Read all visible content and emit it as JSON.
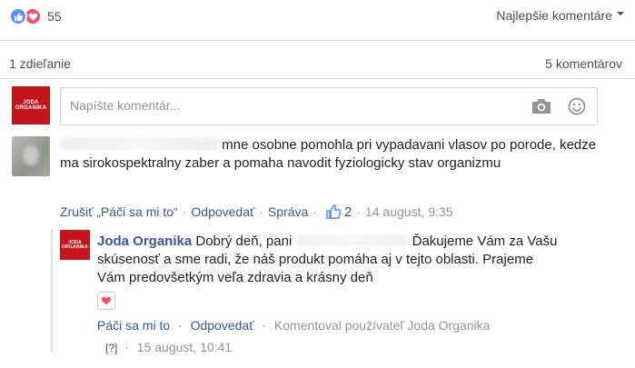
{
  "reactions": {
    "count": "55",
    "icons": [
      "like-icon",
      "love-icon"
    ],
    "like_color": "#5890ff",
    "love_color": "#f25268"
  },
  "sort": {
    "label": "Najlepšie komentáre",
    "icon": "caret-down-icon"
  },
  "stats": {
    "shares": "1 zdieľanie",
    "comments": "5 komentárov"
  },
  "composer": {
    "avatar_logo_line1": "JODA",
    "avatar_logo_line2": "ORGANIKA",
    "placeholder": "Napíšte komentár...",
    "icons": [
      "camera-icon",
      "emoji-icon"
    ]
  },
  "comment": {
    "text": "mne osobne pomohla pri vypadavani vlasov po porode, kedze ma sirokospektralny zaber a pomaha navodit fyziologicky stav organizmu",
    "actions": {
      "unlike": "Zrušiť „Páči sa mi to“",
      "reply": "Odpovedať",
      "message": "Správa"
    },
    "like_count": "2",
    "timestamp": "14 august, 9:35"
  },
  "reply": {
    "avatar_logo_line1": "JODA",
    "avatar_logo_line2": "ORGANIKA",
    "author": "Joda Organika",
    "text_before": "Dobrý deň, pani",
    "text_after": "Ďakujeme Vám za Vašu skúsenosť a sme radi, že náš produkt pomáha aj v tejto oblasti. Prajeme Vám predovšetkým veľa zdravia a krásny deň",
    "reaction_icon": "heart-icon",
    "actions": {
      "like": "Páči sa mi to",
      "reply": "Odpovedať",
      "commented_by": "Komentoval používateľ Joda Organika"
    },
    "unknown": "[?]",
    "timestamp": "15 august, 10:41"
  },
  "colors": {
    "link": "#365899",
    "muted": "#90949c",
    "brand_red": "#c4161c"
  }
}
